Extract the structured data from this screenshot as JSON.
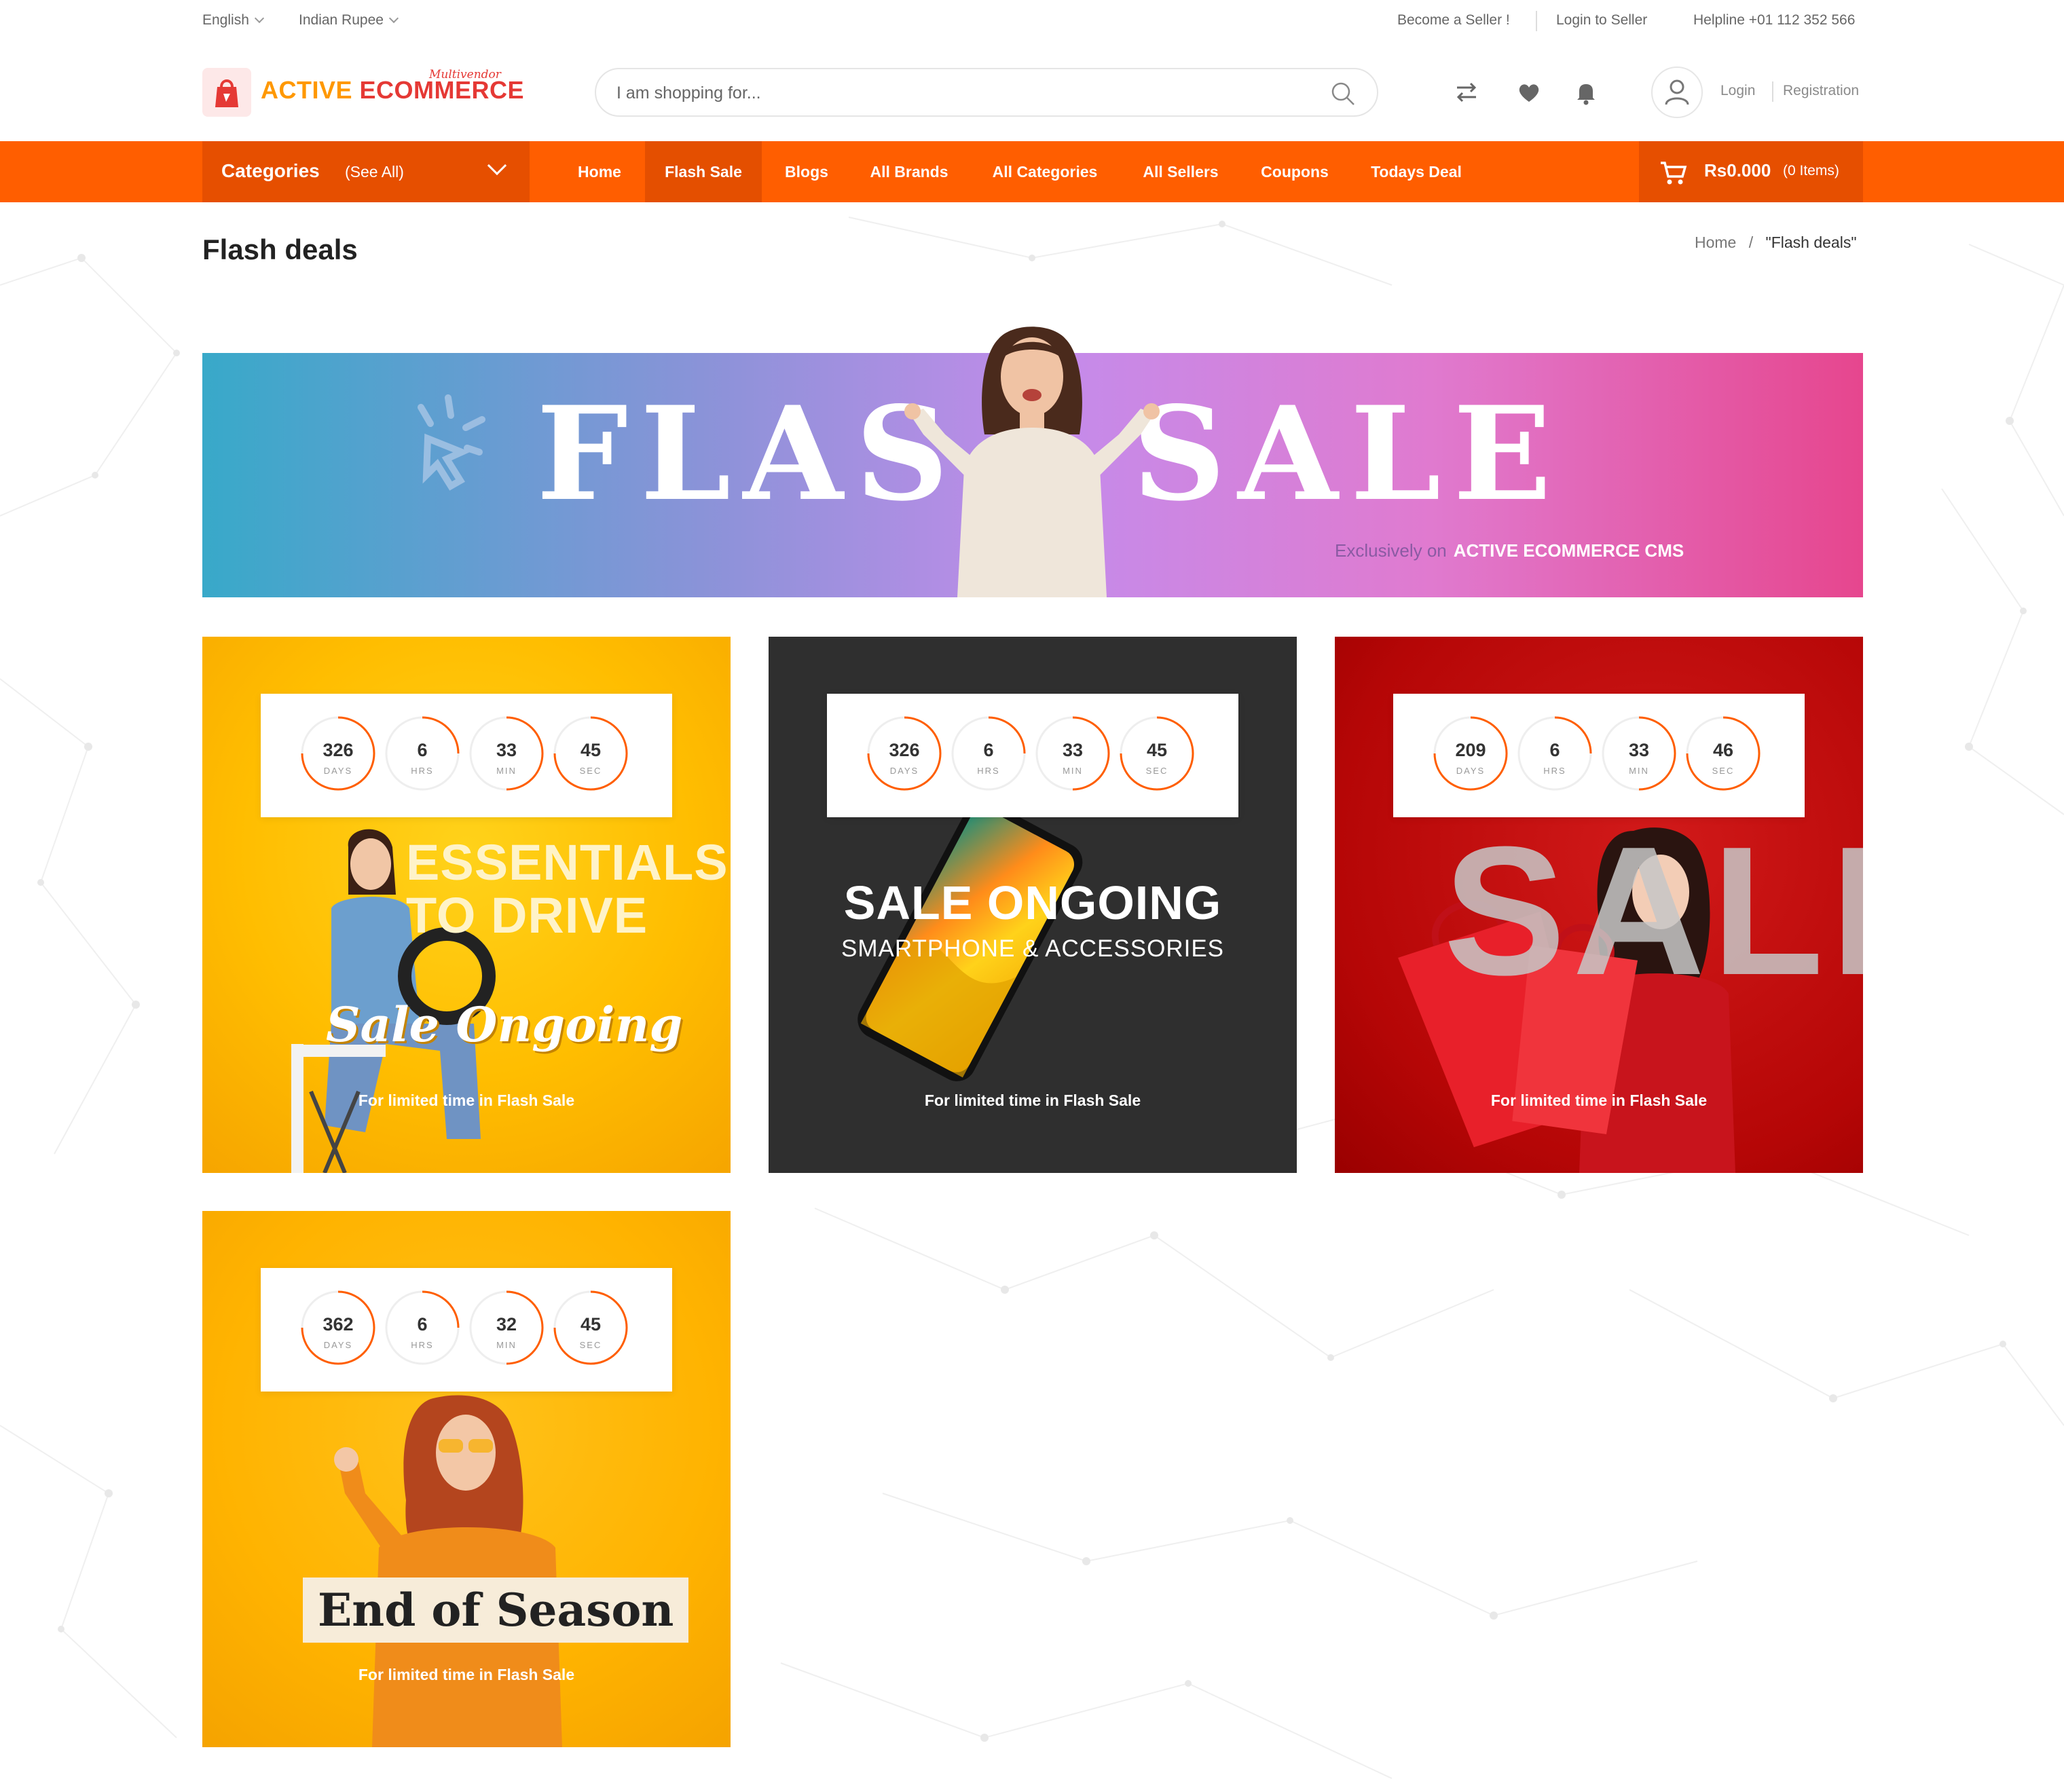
{
  "topbar": {
    "language": "English",
    "currency": "Indian Rupee",
    "become_seller": "Become a Seller !",
    "login_seller": "Login to Seller",
    "helpline": "Helpline +01 112 352 566"
  },
  "header": {
    "logo_part1": "ACTIVE",
    "logo_part2": "ECOMMERCE",
    "logo_tag": "Multivendor",
    "search_placeholder": "I am shopping for...",
    "login": "Login",
    "registration": "Registration"
  },
  "nav": {
    "categories": "Categories",
    "see_all": "(See All)",
    "items": [
      "Home",
      "Flash Sale",
      "Blogs",
      "All Brands",
      "All Categories",
      "All Sellers",
      "Coupons",
      "Todays Deal"
    ],
    "cart_amount": "Rs0.000",
    "cart_items": "(0 Items)"
  },
  "page": {
    "title": "Flash deals",
    "crumb_home": "Home",
    "crumb_sep": "/",
    "crumb_current": "\"Flash deals\""
  },
  "banner": {
    "word1": "FLAS",
    "word2": "SALE",
    "exclusively": "Exclusively on",
    "brand": "ACTIVE ECOMMERCE CMS"
  },
  "deals": [
    {
      "timer": {
        "days": "326",
        "hrs": "6",
        "min": "33",
        "sec": "45"
      },
      "headline1": "ESSENTIALS",
      "headline2": "TO DRIVE",
      "script": "Sale Ongoing",
      "caption": "For limited time in Flash Sale"
    },
    {
      "timer": {
        "days": "326",
        "hrs": "6",
        "min": "33",
        "sec": "45"
      },
      "headline1": "SALE ONGOING",
      "headline2": "SMARTPHONE & ACCESSORIES",
      "caption": "For limited time in Flash Sale"
    },
    {
      "timer": {
        "days": "209",
        "hrs": "6",
        "min": "33",
        "sec": "46"
      },
      "bgword": "SALE",
      "caption": "For limited time in Flash Sale"
    },
    {
      "timer": {
        "days": "362",
        "hrs": "6",
        "min": "32",
        "sec": "45"
      },
      "headline1": "End of Season",
      "caption": "For limited time in Flash Sale"
    }
  ],
  "timer_labels": {
    "days": "DAYS",
    "hrs": "HRS",
    "min": "MIN",
    "sec": "SEC"
  },
  "colors": {
    "accent": "#ff5e00",
    "accent_dark": "#e64f00",
    "ring": "#ff5e00"
  }
}
